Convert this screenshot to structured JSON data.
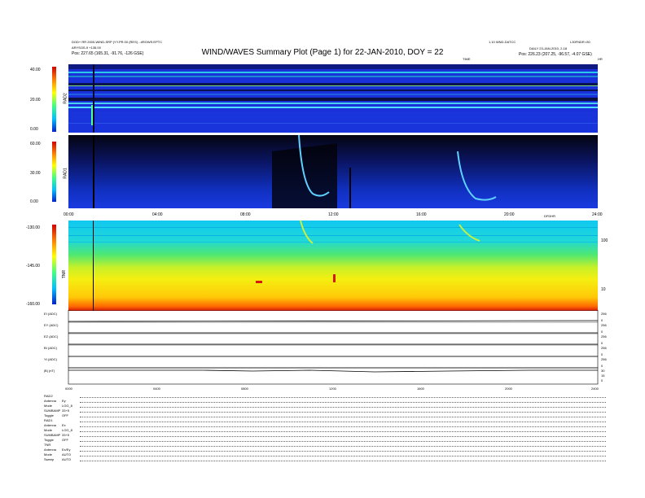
{
  "header": {
    "title": "WIND/WAVES Summary Plot (Page 1) for 22-JAN-2010, DOY = 22",
    "left_line1": "DOD+ RR 2000-WIND-SRP (YY.PR.00 (RES) - #ROWS:EPTC",
    "left_line2": "ARYSOS-9 +135.00",
    "left_line3": "Pos:  227.65 (165.31, -91.76, -126 GSE)",
    "right_line1": "L30FNDR.r30",
    "right_line2": "1.10 WND-DATCC",
    "right_line3": "DAILY 23-JAN-2010, 2-18",
    "right_line4": "Pos:  226.23 (207.25, -96.57, -4.07 GSE)",
    "time_label_top": "TIME",
    "hours_label": "HR"
  },
  "colors": {
    "rad2_bg": "#1a2fd6",
    "rad1_bg": "#0a1a9a",
    "tnr_red": "#d41a0a",
    "tnr_yellow": "#f5ef10",
    "tnr_green": "#3fe080",
    "tnr_cyan": "#10c8f0"
  },
  "chart_data": [
    {
      "type": "heatmap",
      "panel": "RAD2",
      "ylabel": "RAD2",
      "ylim": [
        0,
        40
      ],
      "y_ticks": [
        "40.00",
        "20.00",
        "0.00"
      ],
      "colorscale": "blue-green-yellow-red"
    },
    {
      "type": "heatmap",
      "panel": "RAD1",
      "ylabel": "RAD1",
      "ylim": [
        0,
        60
      ],
      "y_ticks": [
        "60.00",
        "30.00",
        "0.00"
      ],
      "x_ticks": [
        "00:00",
        "04:00",
        "08:00",
        "12:00",
        "16:00",
        "20:00",
        "24:00"
      ],
      "x_axis_label": "DFDHR"
    },
    {
      "type": "heatmap",
      "panel": "TNR",
      "ylabel": "TNR",
      "ylim": [
        -160,
        -130
      ],
      "y_ticks": [
        "-130.00",
        "-145.00",
        "-160.00"
      ],
      "right_ticks": [
        "100",
        "10"
      ],
      "right_unit": "kHz"
    },
    {
      "type": "line",
      "panel": "housekeeping",
      "rows": [
        {
          "label": "EI (ADC)",
          "right": [
            "256",
            "0"
          ]
        },
        {
          "label": "EY (ADC)",
          "right": [
            "256",
            "0"
          ]
        },
        {
          "label": "EZ (ADC)",
          "right": [
            "256",
            "0"
          ]
        },
        {
          "label": "BI (ADC)",
          "right": [
            "256",
            "0"
          ]
        },
        {
          "label": "Yt (ADC)",
          "right": [
            "256",
            "0"
          ]
        },
        {
          "label": "|B| (nT)",
          "right": [
            "30",
            "15",
            "0"
          ]
        }
      ],
      "x_ticks": [
        "0000",
        "0400",
        "0800",
        "1200",
        "1600",
        "2000",
        "2400"
      ]
    }
  ],
  "footer": {
    "rows": [
      {
        "k": "RAD2",
        "v": ""
      },
      {
        "k": "Antenna",
        "v": "Ey"
      },
      {
        "k": "Mode",
        "v": "LOG_8"
      },
      {
        "k": "SUMBAMP",
        "v": "33+5"
      },
      {
        "k": "Toggle",
        "v": "OFF"
      },
      {
        "k": "RAD1",
        "v": ""
      },
      {
        "k": "Antenna",
        "v": "Ex"
      },
      {
        "k": "Mode",
        "v": "LOG_8"
      },
      {
        "k": "SUMBAMP",
        "v": "33+5"
      },
      {
        "k": "Toggle",
        "v": "OFF"
      },
      {
        "k": "TNR",
        "v": ""
      },
      {
        "k": "Antenna",
        "v": "Ex/Ey"
      },
      {
        "k": "Mode",
        "v": "AUTO"
      },
      {
        "k": "Sweep",
        "v": "AUTO"
      }
    ]
  }
}
